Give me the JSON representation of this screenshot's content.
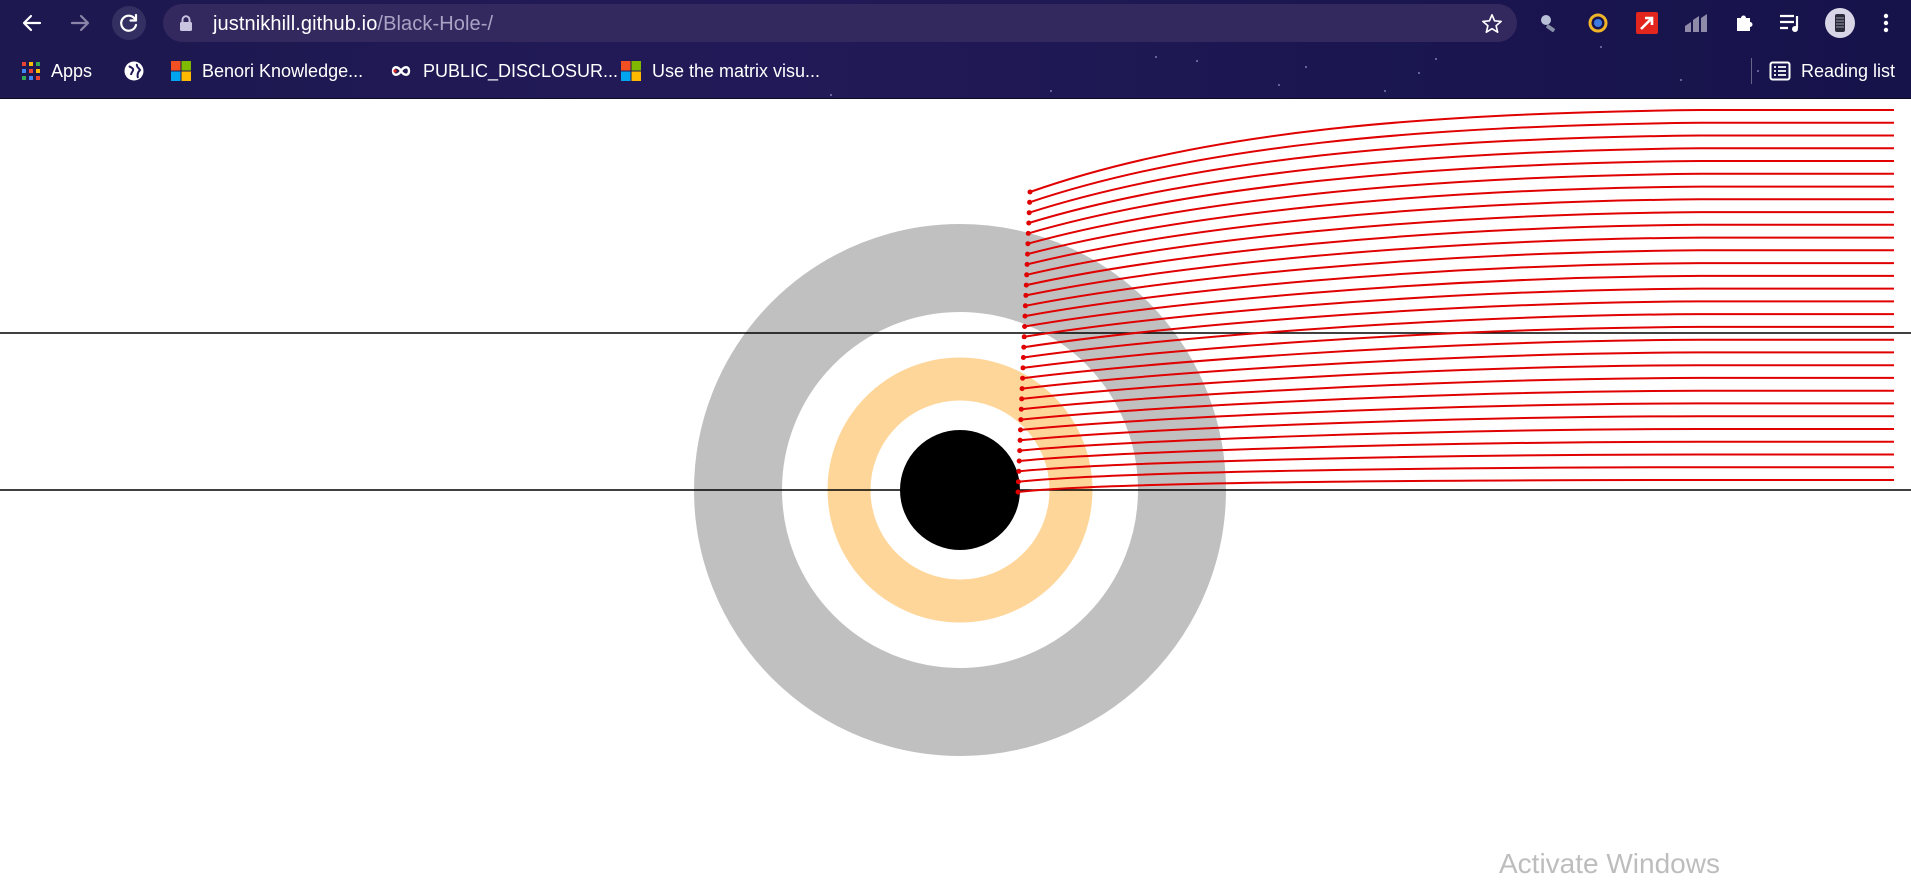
{
  "browser": {
    "nav": {
      "back_icon": "arrow-left-icon",
      "forward_icon": "arrow-right-icon",
      "reload_icon": "reload-icon"
    },
    "address_bar": {
      "host": "justnikhill.github.io",
      "path": "/Black-Hole-/"
    },
    "extension_icons": [
      "key-search-icon",
      "q-ring-extension-icon",
      "red-arrow-extension-icon",
      "chart-extension-icon",
      "puzzle-icon",
      "media-queue-icon",
      "profile-avatar",
      "more-menu-icon"
    ],
    "bookmarks": [
      {
        "label": "Apps",
        "icon": "apps-grid-icon"
      },
      {
        "label": "",
        "icon": "globe-icon"
      },
      {
        "label": "Benori Knowledge...",
        "icon": "microsoft-logo-icon"
      },
      {
        "label": "PUBLIC_DISCLOSUR...",
        "icon": "infinity-icon"
      },
      {
        "label": "Use the matrix visu...",
        "icon": "microsoft-logo-icon"
      }
    ],
    "reading_list": {
      "label": "Reading list",
      "icon": "reading-list-icon"
    }
  },
  "simulation": {
    "black_hole": {
      "color": "#000000"
    },
    "photon_ring": {
      "color": "#ffd699"
    },
    "outer_ring": {
      "color": "#c0c0c0"
    },
    "ray_color": "#e00000",
    "ray_count": 30
  },
  "overlay": {
    "watermark": "Activate Windows"
  }
}
